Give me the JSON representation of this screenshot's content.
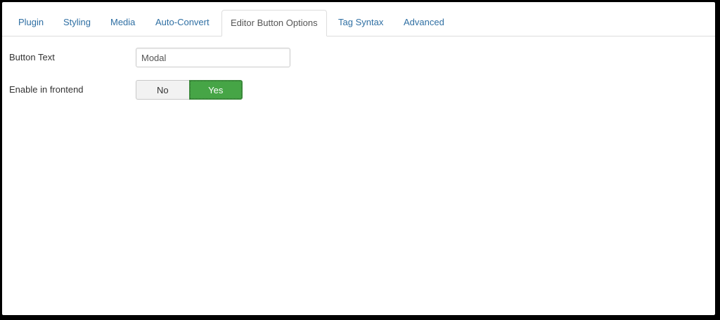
{
  "tabs": [
    {
      "label": "Plugin"
    },
    {
      "label": "Styling"
    },
    {
      "label": "Media"
    },
    {
      "label": "Auto-Convert"
    },
    {
      "label": "Editor Button Options",
      "active": true
    },
    {
      "label": "Tag Syntax"
    },
    {
      "label": "Advanced"
    }
  ],
  "fields": {
    "button_text": {
      "label": "Button Text",
      "value": "Modal"
    },
    "enable_frontend": {
      "label": "Enable in frontend",
      "options": [
        "No",
        "Yes"
      ],
      "selected": "Yes"
    }
  },
  "colors": {
    "tab_link": "#2f6fa3",
    "toggle_active": "#46a546",
    "toggle_inactive": "#f2f2f2"
  }
}
